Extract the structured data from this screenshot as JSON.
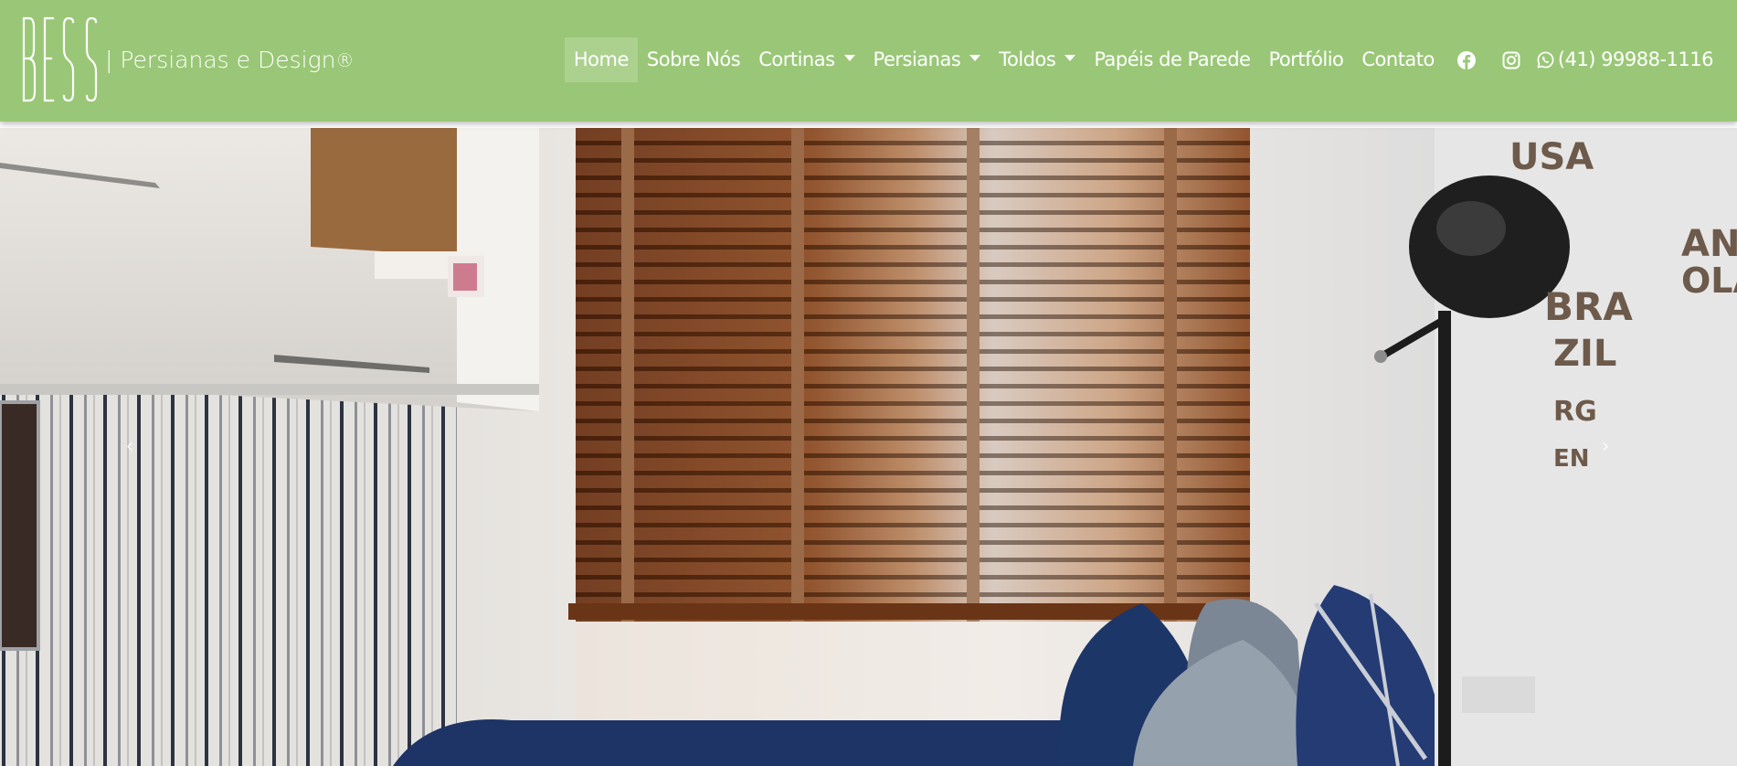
{
  "brand": {
    "logo_text": "BESS",
    "tagline": "| Persianas e Design",
    "registered_mark": "®"
  },
  "nav": {
    "items": [
      {
        "label": "Home",
        "active": true,
        "dropdown": false
      },
      {
        "label": "Sobre Nós",
        "active": false,
        "dropdown": false
      },
      {
        "label": "Cortinas",
        "active": false,
        "dropdown": true
      },
      {
        "label": "Persianas",
        "active": false,
        "dropdown": true
      },
      {
        "label": "Toldos",
        "active": false,
        "dropdown": true
      },
      {
        "label": "Papéis de Parede",
        "active": false,
        "dropdown": false
      },
      {
        "label": "Portfólio",
        "active": false,
        "dropdown": false
      },
      {
        "label": "Contato",
        "active": false,
        "dropdown": false
      }
    ],
    "social_icons": [
      "facebook-icon",
      "instagram-icon"
    ],
    "phone": "(41) 99988-1116",
    "phone_icon": "whatsapp-icon"
  },
  "carousel": {
    "prev_icon": "‹",
    "next_icon": "›",
    "slide_image": "bedroom with wooden venetian blinds"
  },
  "colors": {
    "navbar_bg": "#9ac777",
    "nav_text": "#ffffff",
    "blind_wood": "#7a3d1b"
  }
}
